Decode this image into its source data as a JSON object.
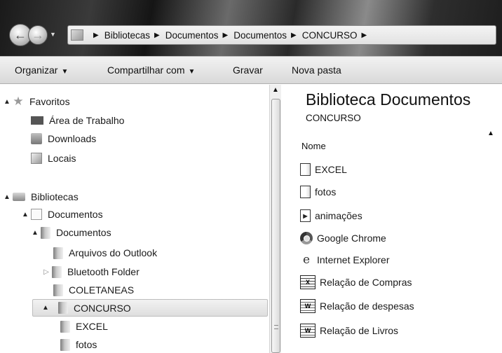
{
  "address_bar": {
    "breadcrumbs": [
      "Bibliotecas",
      "Documentos",
      "Documentos",
      "CONCURSO"
    ]
  },
  "toolbar": {
    "organize": "Organizar",
    "share": "Compartilhar com",
    "burn": "Gravar",
    "new_folder": "Nova pasta"
  },
  "nav_tree": {
    "favorites": "Favoritos",
    "desktop": "Área de Trabalho",
    "downloads": "Downloads",
    "places": "Locais",
    "libraries": "Bibliotecas",
    "documents_lib": "Documentos",
    "my_documents": "Documentos",
    "outlook_files": "Arquivos do Outlook",
    "bluetooth": "Bluetooth Folder",
    "coletaneas": "COLETANEAS",
    "concurso": "CONCURSO",
    "excel": "EXCEL",
    "fotos": "fotos"
  },
  "content": {
    "title": "Biblioteca Documentos",
    "subtitle": "CONCURSO",
    "column_name": "Nome",
    "files": [
      {
        "name": "EXCEL",
        "icon": "folder-icon"
      },
      {
        "name": "fotos",
        "icon": "folder-icon"
      },
      {
        "name": "animações",
        "icon": "media-folder-icon"
      },
      {
        "name": "Google Chrome",
        "icon": "chrome-icon"
      },
      {
        "name": "Internet Explorer",
        "icon": "ie-icon"
      },
      {
        "name": "Relação de Compras",
        "icon": "excel-doc-icon"
      },
      {
        "name": "Relação de despesas",
        "icon": "word-doc-icon"
      },
      {
        "name": "Relação de Livros",
        "icon": "word-doc-icon"
      }
    ]
  }
}
